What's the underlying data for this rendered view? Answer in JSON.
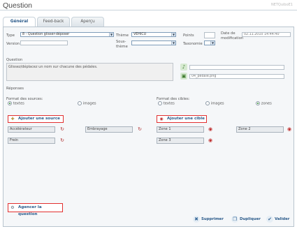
{
  "window": {
    "title": "Question",
    "brand": "NETQuiboE1"
  },
  "tabs": [
    {
      "label": "Général",
      "active": true
    },
    {
      "label": "Feed-back",
      "active": false
    },
    {
      "label": "Aperçu",
      "active": false
    }
  ],
  "form": {
    "type_label": "Type",
    "type_value": "8 - Question glisser-déposer",
    "theme_label": "Thème",
    "theme_value": "VEHICU",
    "points_label": "Points",
    "points_value": "",
    "date_label": "Date de modification",
    "date_value": "02.11.2010 14:44:40",
    "version_label": "Version",
    "version_value": "",
    "sous_theme_label": "Sous-thème",
    "sous_theme_value": "",
    "taxonomie_label": "Taxonomie",
    "taxonomie_value": ""
  },
  "question": {
    "label": "Question",
    "text": "Glissez/déplacez un nom sur chacune des pédales.",
    "media_text": "",
    "image_file": "04_pedale.png"
  },
  "reponses": {
    "label": "Réponses",
    "sources_format_label": "Format des sources:",
    "cibles_format_label": "Format des cibles:",
    "source_options": [
      {
        "label": "textes",
        "selected": true
      },
      {
        "label": "images",
        "selected": false
      }
    ],
    "cible_options": [
      {
        "label": "textes",
        "selected": false
      },
      {
        "label": "images",
        "selected": false
      },
      {
        "label": "zones",
        "selected": true
      }
    ],
    "add_source_label": "Ajouter une source",
    "add_cible_label": "Ajouter une cible",
    "sources": [
      "Accélérateur",
      "Embrayage",
      "Frein"
    ],
    "cibles": [
      "Zone 1",
      "Zone 2",
      "Zone 3"
    ]
  },
  "actions": {
    "agencer_label": "Agencer la question",
    "supprimer_label": "Supprimer",
    "dupliquer_label": "Dupliquer",
    "valider_label": "Valider"
  },
  "colors": {
    "accent": "#2a5a8a",
    "highlight_border": "#e23030",
    "panel_bg": "#f5f7f9"
  }
}
